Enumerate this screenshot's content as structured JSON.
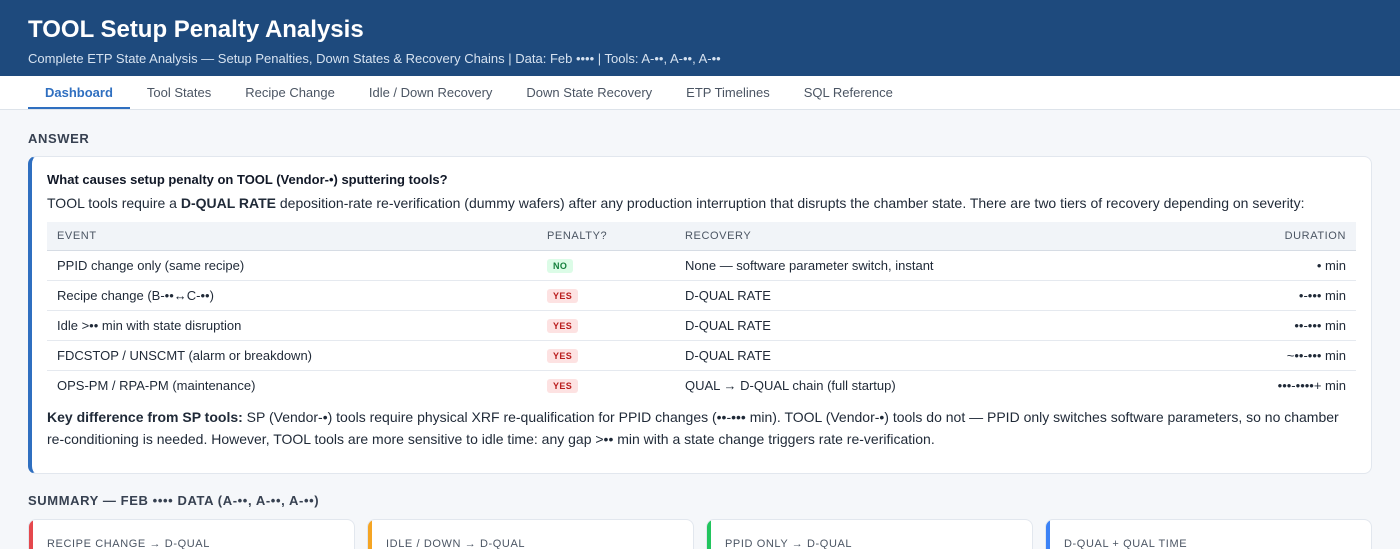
{
  "header": {
    "title": "TOOL Setup Penalty Analysis",
    "subtitle": "Complete ETP State Analysis — Setup Penalties, Down States & Recovery Chains | Data: Feb •••• | Tools: A-••, A-••, A-••"
  },
  "tabs": [
    {
      "label": "Dashboard"
    },
    {
      "label": "Tool States"
    },
    {
      "label": "Recipe Change"
    },
    {
      "label": "Idle / Down Recovery"
    },
    {
      "label": "Down State Recovery"
    },
    {
      "label": "ETP Timelines"
    },
    {
      "label": "SQL Reference"
    }
  ],
  "answer": {
    "section_title": "ANSWER",
    "question": "What causes setup penalty on TOOL (Vendor-•) sputtering tools?",
    "intro_pre": "TOOL tools require a ",
    "intro_bold": "D-QUAL RATE",
    "intro_post": " deposition-rate re-verification (dummy wafers) after any production interruption that disrupts the chamber state. There are two tiers of recovery depending on severity:",
    "table": {
      "headers": {
        "event": "EVENT",
        "penalty": "PENALTY?",
        "recovery": "RECOVERY",
        "duration": "DURATION"
      },
      "rows": [
        {
          "event": "PPID change only (same recipe)",
          "penalty": "NO",
          "recovery": "None — software parameter switch, instant",
          "duration": "• min"
        },
        {
          "event": "Recipe change (B-••↔C-••)",
          "penalty": "YES",
          "recovery": "D-QUAL RATE",
          "duration": "•-••• min"
        },
        {
          "event": "Idle >•• min with state disruption",
          "penalty": "YES",
          "recovery": "D-QUAL RATE",
          "duration": "••-••• min"
        },
        {
          "event": "FDCSTOP / UNSCMT (alarm or breakdown)",
          "penalty": "YES",
          "recovery": "D-QUAL RATE",
          "duration": "~••-••• min"
        },
        {
          "event": "OPS-PM / RPA-PM (maintenance)",
          "penalty": "YES",
          "recovery": "QUAL → D-QUAL chain (full startup)",
          "duration": "•••-••••+ min"
        }
      ]
    },
    "key_bold": "Key difference from SP tools:",
    "key_text": " SP (Vendor-•) tools require physical XRF re-qualification for PPID changes (••-••• min). TOOL (Vendor-•) tools do not — PPID only switches software parameters, so no chamber re-conditioning is needed. However, TOOL tools are more sensitive to idle time: any gap >•• min with a state change triggers rate re-verification."
  },
  "summary": {
    "section_title": "SUMMARY — FEB •••• DATA (A-••, A-••, A-••)",
    "cards": [
      {
        "label": "RECIPE CHANGE → D-QUAL",
        "color": "#e5484d"
      },
      {
        "label": "IDLE / DOWN → D-QUAL",
        "color": "#f5a524"
      },
      {
        "label": "PPID ONLY → D-QUAL",
        "color": "#22c55e"
      },
      {
        "label": "D-QUAL + QUAL TIME",
        "color": "#3b82f6"
      }
    ]
  }
}
